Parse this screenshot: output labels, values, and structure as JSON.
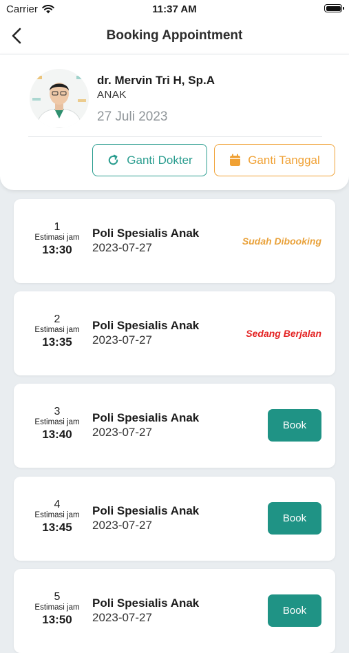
{
  "status_bar": {
    "carrier": "Carrier",
    "time": "11:37 AM"
  },
  "nav": {
    "title": "Booking Appointment"
  },
  "doctor": {
    "name": "dr. Mervin Tri H, Sp.A",
    "specialty": "ANAK",
    "date": "27 Juli 2023"
  },
  "actions": {
    "change_doctor": "Ganti Dokter",
    "change_date": "Ganti Tanggal"
  },
  "colors": {
    "primary": "#1f9385",
    "accent_orange": "#f0a134",
    "status_booked": "#e9a23b",
    "status_running": "#e42424"
  },
  "slots": [
    {
      "number": "1",
      "estimate_label": "Estimasi jam",
      "time": "13:30",
      "poli": "Poli Spesialis Anak",
      "date": "2023-07-27",
      "status": "Sudah Dibooking"
    },
    {
      "number": "2",
      "estimate_label": "Estimasi jam",
      "time": "13:35",
      "poli": "Poli Spesialis Anak",
      "date": "2023-07-27",
      "status": "Sedang Berjalan"
    },
    {
      "number": "3",
      "estimate_label": "Estimasi jam",
      "time": "13:40",
      "poli": "Poli Spesialis Anak",
      "date": "2023-07-27",
      "action": "Book"
    },
    {
      "number": "4",
      "estimate_label": "Estimasi jam",
      "time": "13:45",
      "poli": "Poli Spesialis Anak",
      "date": "2023-07-27",
      "action": "Book"
    },
    {
      "number": "5",
      "estimate_label": "Estimasi jam",
      "time": "13:50",
      "poli": "Poli Spesialis Anak",
      "date": "2023-07-27",
      "action": "Book"
    }
  ]
}
